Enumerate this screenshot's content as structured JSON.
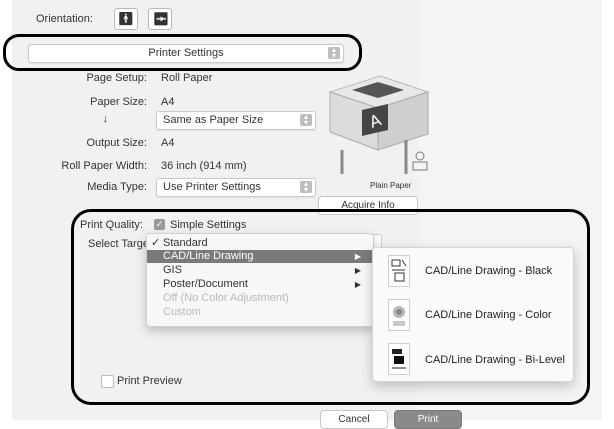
{
  "orientation": {
    "label": "Orientation:",
    "portrait_icon": "portrait-person-icon",
    "landscape_icon": "landscape-person-icon"
  },
  "panel_popup": {
    "value": "Printer Settings"
  },
  "fields": {
    "page_setup": {
      "label": "Page Setup:",
      "value": "Roll Paper"
    },
    "paper_size": {
      "label": "Paper Size:",
      "value": "A4"
    },
    "arrow_label": "↓",
    "arrow_popup": "Same as Paper Size",
    "output_size": {
      "label": "Output Size:",
      "value": "A4"
    },
    "roll_width": {
      "label": "Roll Paper Width:",
      "value": "36 inch (914 mm)"
    },
    "media_type": {
      "label": "Media Type:",
      "value": "Use Printer Settings"
    }
  },
  "preview": {
    "caption": "Plain Paper",
    "acquire_button": "Acquire Info"
  },
  "print_quality": {
    "label": "Print Quality:",
    "checkbox_label": "Simple Settings",
    "checked": true
  },
  "select_target": {
    "label": "Select Target"
  },
  "target_menu": [
    {
      "label": "Standard",
      "checked": true,
      "submenu": false,
      "disabled": false
    },
    {
      "label": "CAD/Line Drawing",
      "checked": false,
      "submenu": true,
      "disabled": false,
      "highlight": true
    },
    {
      "label": "GIS",
      "checked": false,
      "submenu": true,
      "disabled": false
    },
    {
      "label": "Poster/Document",
      "checked": false,
      "submenu": true,
      "disabled": false
    },
    {
      "label": "Off (No Color Adjustment)",
      "checked": false,
      "submenu": false,
      "disabled": true
    },
    {
      "label": "Custom",
      "checked": false,
      "submenu": false,
      "disabled": true
    }
  ],
  "submenu": [
    {
      "label": "CAD/Line Drawing - Black"
    },
    {
      "label": "CAD/Line Drawing - Color"
    },
    {
      "label": "CAD/Line Drawing - Bi-Level"
    }
  ],
  "print_preview": {
    "label": "Print Preview"
  },
  "buttons": {
    "cancel": "Cancel",
    "print": "Print"
  },
  "colors": {
    "highlight": "#7a7a7a",
    "callout": "#000000",
    "print_button": "#8a8a8a"
  }
}
